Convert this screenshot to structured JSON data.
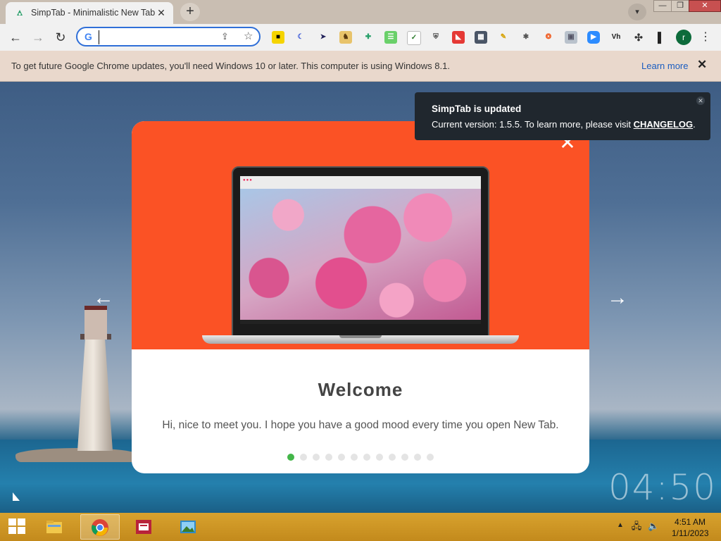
{
  "browser": {
    "tab_title": "SimpTab - Minimalistic New Tab",
    "tab_close_glyph": "✕",
    "new_tab_glyph": "+",
    "omnibox_value": "",
    "omnibox_engine_glyph": "G",
    "profile_initial": "r",
    "extensions": [
      "vocab-builder-icon",
      "grammarly-icon",
      "cursor-icon",
      "dog-extension-icon",
      "puzzle-green-icon",
      "subtitles-icon",
      "check-list-icon",
      "shield-icon",
      "red-arrow-icon",
      "calculator-icon",
      "pencil-icon",
      "bug-icon",
      "colorful-fox-icon",
      "image-icon",
      "zoom-icon",
      "vh-icon",
      "extensions-puzzle-icon",
      "sidebar-icon"
    ],
    "ext_vh_label": "Vh"
  },
  "infobar": {
    "message": "To get future Google Chrome updates, you'll need Windows 10 or later. This computer is using Windows 8.1.",
    "link": "Learn more",
    "close_glyph": "✕"
  },
  "toast": {
    "title": "SimpTab is updated",
    "message_prefix": "Current version: 1.5.5. To learn more, please visit ",
    "link": "CHANGELOG",
    "message_suffix": "."
  },
  "modal": {
    "title": "Welcome",
    "text": "Hi, nice to meet you. I hope you have a good mood every time you open New Tab.",
    "close_glyph": "✕",
    "prev_glyph": "←",
    "next_glyph": "→",
    "page_count": 12,
    "active_page": 1
  },
  "page": {
    "clock": "04:50"
  },
  "taskbar": {
    "apps": [
      "file-explorer-icon",
      "chrome-icon",
      "reader-app-icon",
      "photos-icon"
    ],
    "time": "4:51 AM",
    "date": "1/11/2023"
  },
  "colors": {
    "modal_hero": "#fb5225",
    "active_dot": "#43b649",
    "taskbar": "#d8a22e"
  }
}
